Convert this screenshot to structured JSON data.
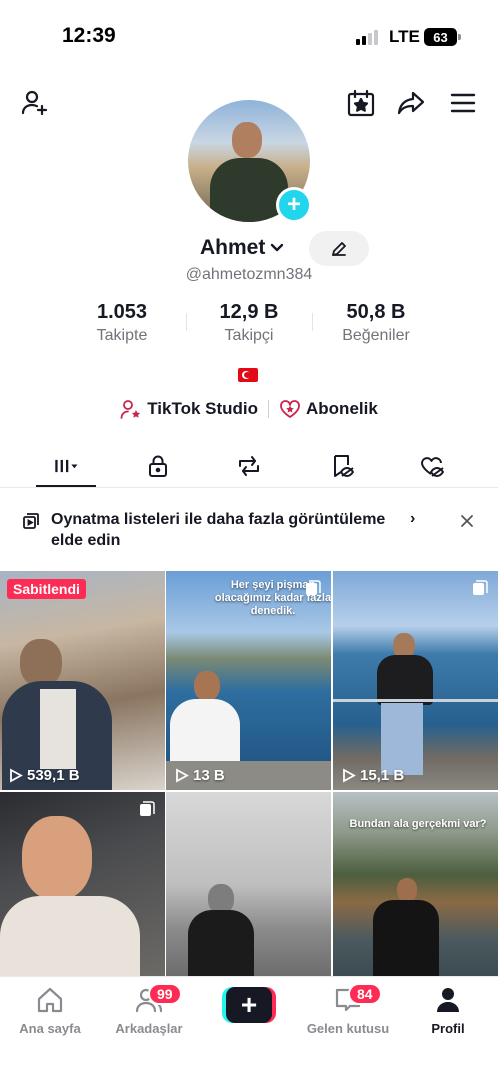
{
  "status_bar": {
    "time": "12:39",
    "network": "LTE",
    "battery": "63"
  },
  "header_icons": [
    "add-friend-icon",
    "calendar-star-icon",
    "share-icon",
    "menu-icon"
  ],
  "profile": {
    "name": "Ahmet",
    "username": "@ahmetozmn384",
    "stats": [
      {
        "value": "1.053",
        "label": "Takipte"
      },
      {
        "value": "12,9 B",
        "label": "Takipçi"
      },
      {
        "value": "50,8 B",
        "label": "Beğeniler"
      }
    ],
    "flag": "turkey-flag",
    "links": [
      {
        "label": "TikTok Studio",
        "icon": "person-star-icon"
      },
      {
        "label": "Abonelik",
        "icon": "heart-star-icon"
      }
    ]
  },
  "tabs": [
    "videos-tab",
    "private-tab",
    "reposts-tab",
    "favorites-tab",
    "liked-tab"
  ],
  "banner": {
    "text": "Oynatma listeleri ile daha fazla görüntüleme elde edin",
    "arrow": "›"
  },
  "videos": [
    {
      "pinned": "Sabitlendi",
      "views": "539,1 B",
      "caption": ""
    },
    {
      "pinned": "",
      "views": "13 B",
      "caption": "Her şeyi pişman olacağımız kadar fazla denedik."
    },
    {
      "pinned": "",
      "views": "15,1 B",
      "caption": ""
    },
    {
      "pinned": "",
      "views": "",
      "caption": ""
    },
    {
      "pinned": "",
      "views": "",
      "caption": ""
    },
    {
      "pinned": "",
      "views": "",
      "caption": "Bundan ala gerçekmi var?"
    }
  ],
  "bottom_nav": {
    "home": "Ana sayfa",
    "friends": "Arkadaşlar",
    "friends_badge": "99",
    "create": "+",
    "inbox": "Gelen kutusu",
    "inbox_badge": "84",
    "profile": "Profil"
  },
  "colors": {
    "accent": "#fe2c55",
    "cyan": "#20d5ec",
    "text": "#161823",
    "muted": "#73747b"
  }
}
